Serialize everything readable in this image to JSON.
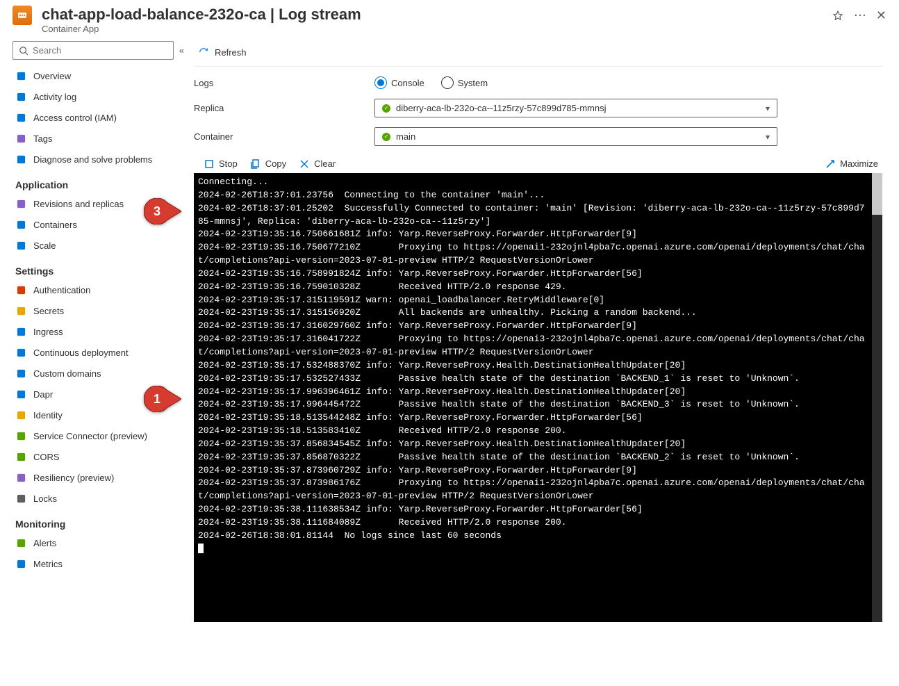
{
  "header": {
    "title": "chat-app-load-balance-232o-ca | Log stream",
    "subtitle": "Container App"
  },
  "sidebar": {
    "search_placeholder": "Search",
    "top": [
      {
        "label": "Overview",
        "icon": "overview"
      },
      {
        "label": "Activity log",
        "icon": "activity"
      },
      {
        "label": "Access control (IAM)",
        "icon": "iam"
      },
      {
        "label": "Tags",
        "icon": "tags"
      },
      {
        "label": "Diagnose and solve problems",
        "icon": "diagnose"
      }
    ],
    "sections": [
      {
        "title": "Application",
        "items": [
          {
            "label": "Revisions and replicas",
            "icon": "revisions"
          },
          {
            "label": "Containers",
            "icon": "containers"
          },
          {
            "label": "Scale",
            "icon": "scale"
          }
        ]
      },
      {
        "title": "Settings",
        "items": [
          {
            "label": "Authentication",
            "icon": "auth"
          },
          {
            "label": "Secrets",
            "icon": "secrets"
          },
          {
            "label": "Ingress",
            "icon": "ingress"
          },
          {
            "label": "Continuous deployment",
            "icon": "cd"
          },
          {
            "label": "Custom domains",
            "icon": "domains"
          },
          {
            "label": "Dapr",
            "icon": "dapr"
          },
          {
            "label": "Identity",
            "icon": "identity"
          },
          {
            "label": "Service Connector (preview)",
            "icon": "svc"
          },
          {
            "label": "CORS",
            "icon": "cors"
          },
          {
            "label": "Resiliency (preview)",
            "icon": "resiliency"
          },
          {
            "label": "Locks",
            "icon": "locks"
          }
        ]
      },
      {
        "title": "Monitoring",
        "items": [
          {
            "label": "Alerts",
            "icon": "alerts"
          },
          {
            "label": "Metrics",
            "icon": "metrics"
          }
        ]
      }
    ]
  },
  "main": {
    "refresh": "Refresh",
    "logs_label": "Logs",
    "radio_console": "Console",
    "radio_system": "System",
    "replica_label": "Replica",
    "replica_value": "diberry-aca-lb-232o-ca--11z5rzy-57c899d785-mmnsj",
    "container_label": "Container",
    "container_value": "main",
    "stop": "Stop",
    "copy": "Copy",
    "clear": "Clear",
    "maximize": "Maximize"
  },
  "callouts": {
    "a": "3",
    "b": "1"
  },
  "log_lines": [
    "Connecting...",
    "2024-02-26T18:37:01.23756  Connecting to the container 'main'...",
    "2024-02-26T18:37:01.25202  Successfully Connected to container: 'main' [Revision: 'diberry-aca-lb-232o-ca--11z5rzy-57c899d785-mmnsj', Replica: 'diberry-aca-lb-232o-ca--11z5rzy']",
    "2024-02-23T19:35:16.750661681Z info: Yarp.ReverseProxy.Forwarder.HttpForwarder[9]",
    "2024-02-23T19:35:16.750677210Z       Proxying to https://openai1-232ojnl4pba7c.openai.azure.com/openai/deployments/chat/chat/completions?api-version=2023-07-01-preview HTTP/2 RequestVersionOrLower",
    "2024-02-23T19:35:16.758991824Z info: Yarp.ReverseProxy.Forwarder.HttpForwarder[56]",
    "2024-02-23T19:35:16.759010328Z       Received HTTP/2.0 response 429.",
    "2024-02-23T19:35:17.315119591Z warn: openai_loadbalancer.RetryMiddleware[0]",
    "2024-02-23T19:35:17.315156920Z       All backends are unhealthy. Picking a random backend...",
    "2024-02-23T19:35:17.316029760Z info: Yarp.ReverseProxy.Forwarder.HttpForwarder[9]",
    "2024-02-23T19:35:17.316041722Z       Proxying to https://openai3-232ojnl4pba7c.openai.azure.com/openai/deployments/chat/chat/completions?api-version=2023-07-01-preview HTTP/2 RequestVersionOrLower",
    "2024-02-23T19:35:17.532488370Z info: Yarp.ReverseProxy.Health.DestinationHealthUpdater[20]",
    "2024-02-23T19:35:17.532527433Z       Passive health state of the destination `BACKEND_1` is reset to 'Unknown`.",
    "2024-02-23T19:35:17.996396461Z info: Yarp.ReverseProxy.Health.DestinationHealthUpdater[20]",
    "2024-02-23T19:35:17.996445472Z       Passive health state of the destination `BACKEND_3` is reset to 'Unknown`.",
    "2024-02-23T19:35:18.513544248Z info: Yarp.ReverseProxy.Forwarder.HttpForwarder[56]",
    "2024-02-23T19:35:18.513583410Z       Received HTTP/2.0 response 200.",
    "2024-02-23T19:35:37.856834545Z info: Yarp.ReverseProxy.Health.DestinationHealthUpdater[20]",
    "2024-02-23T19:35:37.856870322Z       Passive health state of the destination `BACKEND_2` is reset to 'Unknown`.",
    "2024-02-23T19:35:37.873960729Z info: Yarp.ReverseProxy.Forwarder.HttpForwarder[9]",
    "2024-02-23T19:35:37.873986176Z       Proxying to https://openai1-232ojnl4pba7c.openai.azure.com/openai/deployments/chat/chat/completions?api-version=2023-07-01-preview HTTP/2 RequestVersionOrLower",
    "2024-02-23T19:35:38.111638534Z info: Yarp.ReverseProxy.Forwarder.HttpForwarder[56]",
    "2024-02-23T19:35:38.111684089Z       Received HTTP/2.0 response 200.",
    "2024-02-26T18:38:01.81144  No logs since last 60 seconds"
  ]
}
